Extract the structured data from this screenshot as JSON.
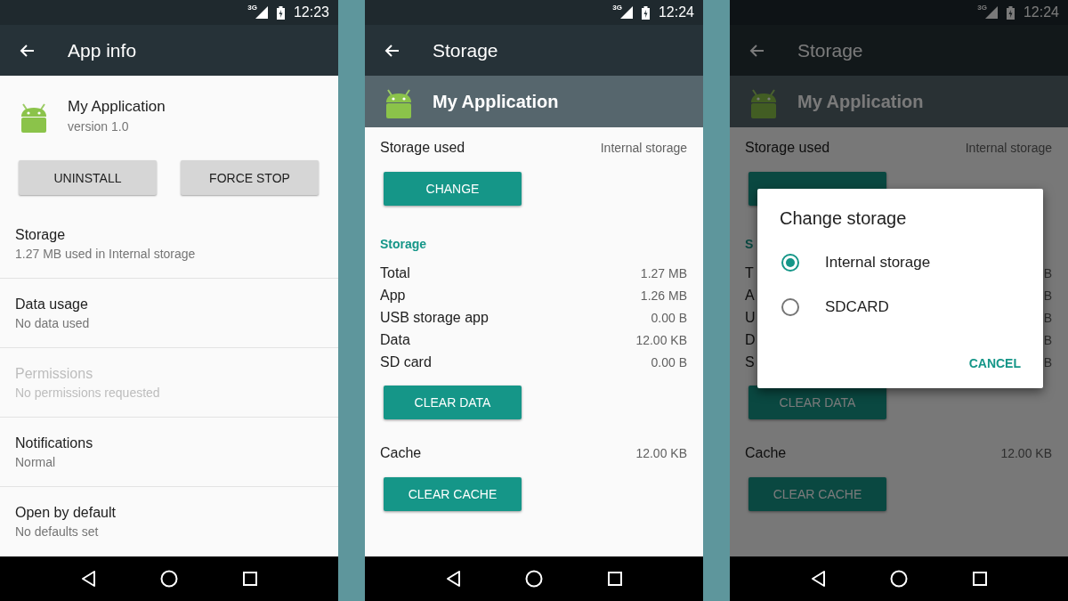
{
  "screens": [
    {
      "kind": "app_info",
      "status_bar": {
        "network": "3G",
        "time": "12:23"
      },
      "app_bar": {
        "title": "App info"
      },
      "app": {
        "name": "My Application",
        "version": "version 1.0"
      },
      "buttons": [
        "UNINSTALL",
        "FORCE STOP"
      ],
      "items": [
        {
          "title": "Storage",
          "subtitle": "1.27 MB used in Internal storage",
          "disabled": false
        },
        {
          "title": "Data usage",
          "subtitle": "No data used",
          "disabled": false
        },
        {
          "title": "Permissions",
          "subtitle": "No permissions requested",
          "disabled": true
        },
        {
          "title": "Notifications",
          "subtitle": "Normal",
          "disabled": false
        },
        {
          "title": "Open by default",
          "subtitle": "No defaults set",
          "disabled": false
        }
      ]
    },
    {
      "kind": "storage",
      "dimmed": false,
      "status_bar": {
        "network": "3G",
        "time": "12:24"
      },
      "app_bar": {
        "title": "Storage"
      },
      "app": {
        "name": "My Application"
      },
      "storage_used": {
        "label": "Storage used",
        "value": "Internal storage"
      },
      "change_button": "CHANGE",
      "section_label": "Storage",
      "rows": [
        {
          "label": "Total",
          "value": "1.27 MB"
        },
        {
          "label": "App",
          "value": "1.26 MB"
        },
        {
          "label": "USB storage app",
          "value": "0.00 B"
        },
        {
          "label": "Data",
          "value": "12.00 KB"
        },
        {
          "label": "SD card",
          "value": "0.00 B"
        }
      ],
      "clear_data_button": "CLEAR DATA",
      "cache": {
        "label": "Cache",
        "value": "12.00 KB"
      },
      "clear_cache_button": "CLEAR CACHE"
    },
    {
      "kind": "storage",
      "dimmed": true,
      "status_bar": {
        "network": "3G",
        "time": "12:24"
      },
      "app_bar": {
        "title": "Storage"
      },
      "app": {
        "name": "My Application"
      },
      "storage_used": {
        "label": "Storage used",
        "value": "Internal storage"
      },
      "section_label": "S",
      "rows": [
        {
          "label": "T",
          "value": "B"
        },
        {
          "label": "A",
          "value": "B"
        },
        {
          "label": "U",
          "value": "B"
        },
        {
          "label": "D",
          "value": "B"
        },
        {
          "label": "S",
          "value": "B"
        }
      ],
      "clear_data_button": "CLEAR DATA",
      "cache": {
        "label": "Cache",
        "value": "12.00 KB"
      },
      "clear_cache_button": "CLEAR CACHE",
      "dialog": {
        "title": "Change storage",
        "options": [
          {
            "label": "Internal storage",
            "selected": true
          },
          {
            "label": "SDCARD",
            "selected": false
          }
        ],
        "cancel": "CANCEL"
      }
    }
  ]
}
